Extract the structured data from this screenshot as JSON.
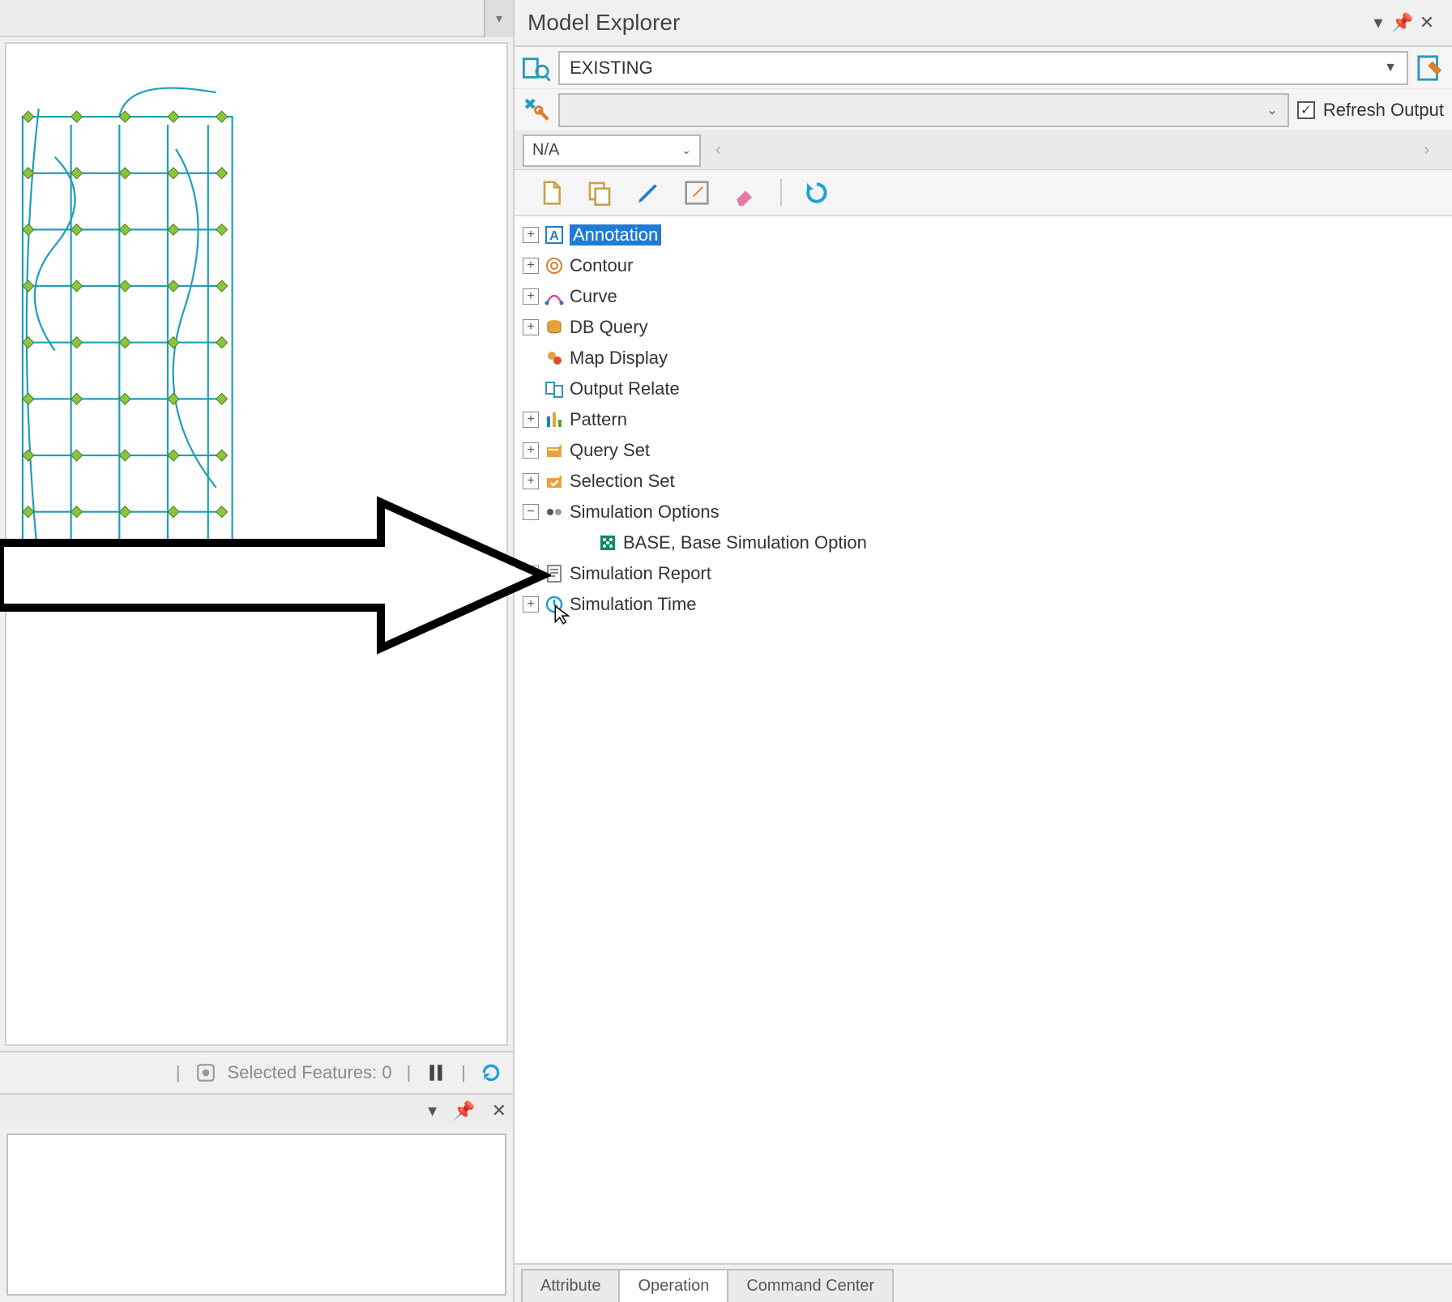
{
  "panel": {
    "title": "Model Explorer",
    "scenario_value": "EXISTING",
    "filter_value": "",
    "refresh_label": "Refresh Output",
    "na_value": "N/A"
  },
  "status": {
    "selected_label": "Selected Features: 0"
  },
  "tree": {
    "items": [
      {
        "label": "Annotation",
        "icon": "A",
        "selected": true,
        "exp": "+"
      },
      {
        "label": "Contour",
        "icon": "contour",
        "exp": "+"
      },
      {
        "label": "Curve",
        "icon": "curve",
        "exp": "+"
      },
      {
        "label": "DB Query",
        "icon": "dbquery",
        "exp": "+"
      },
      {
        "label": "Map Display",
        "icon": "mapdisplay",
        "exp": ""
      },
      {
        "label": "Output Relate",
        "icon": "outputrelate",
        "exp": ""
      },
      {
        "label": "Pattern",
        "icon": "pattern",
        "exp": "+"
      },
      {
        "label": "Query Set",
        "icon": "queryset",
        "exp": "+"
      },
      {
        "label": "Selection Set",
        "icon": "selectionset",
        "exp": "+"
      },
      {
        "label": "Simulation Options",
        "icon": "simoptions",
        "exp": "-"
      },
      {
        "label": "BASE, Base Simulation Option",
        "icon": "simbase",
        "child": true,
        "exp": ""
      },
      {
        "label": "Simulation Report",
        "icon": "simreport",
        "exp": "+"
      },
      {
        "label": "Simulation Time",
        "icon": "simtime",
        "exp": "+"
      }
    ]
  },
  "tabs": {
    "items": [
      {
        "label": "Attribute",
        "active": false
      },
      {
        "label": "Operation",
        "active": true
      },
      {
        "label": "Command Center",
        "active": false
      }
    ]
  }
}
